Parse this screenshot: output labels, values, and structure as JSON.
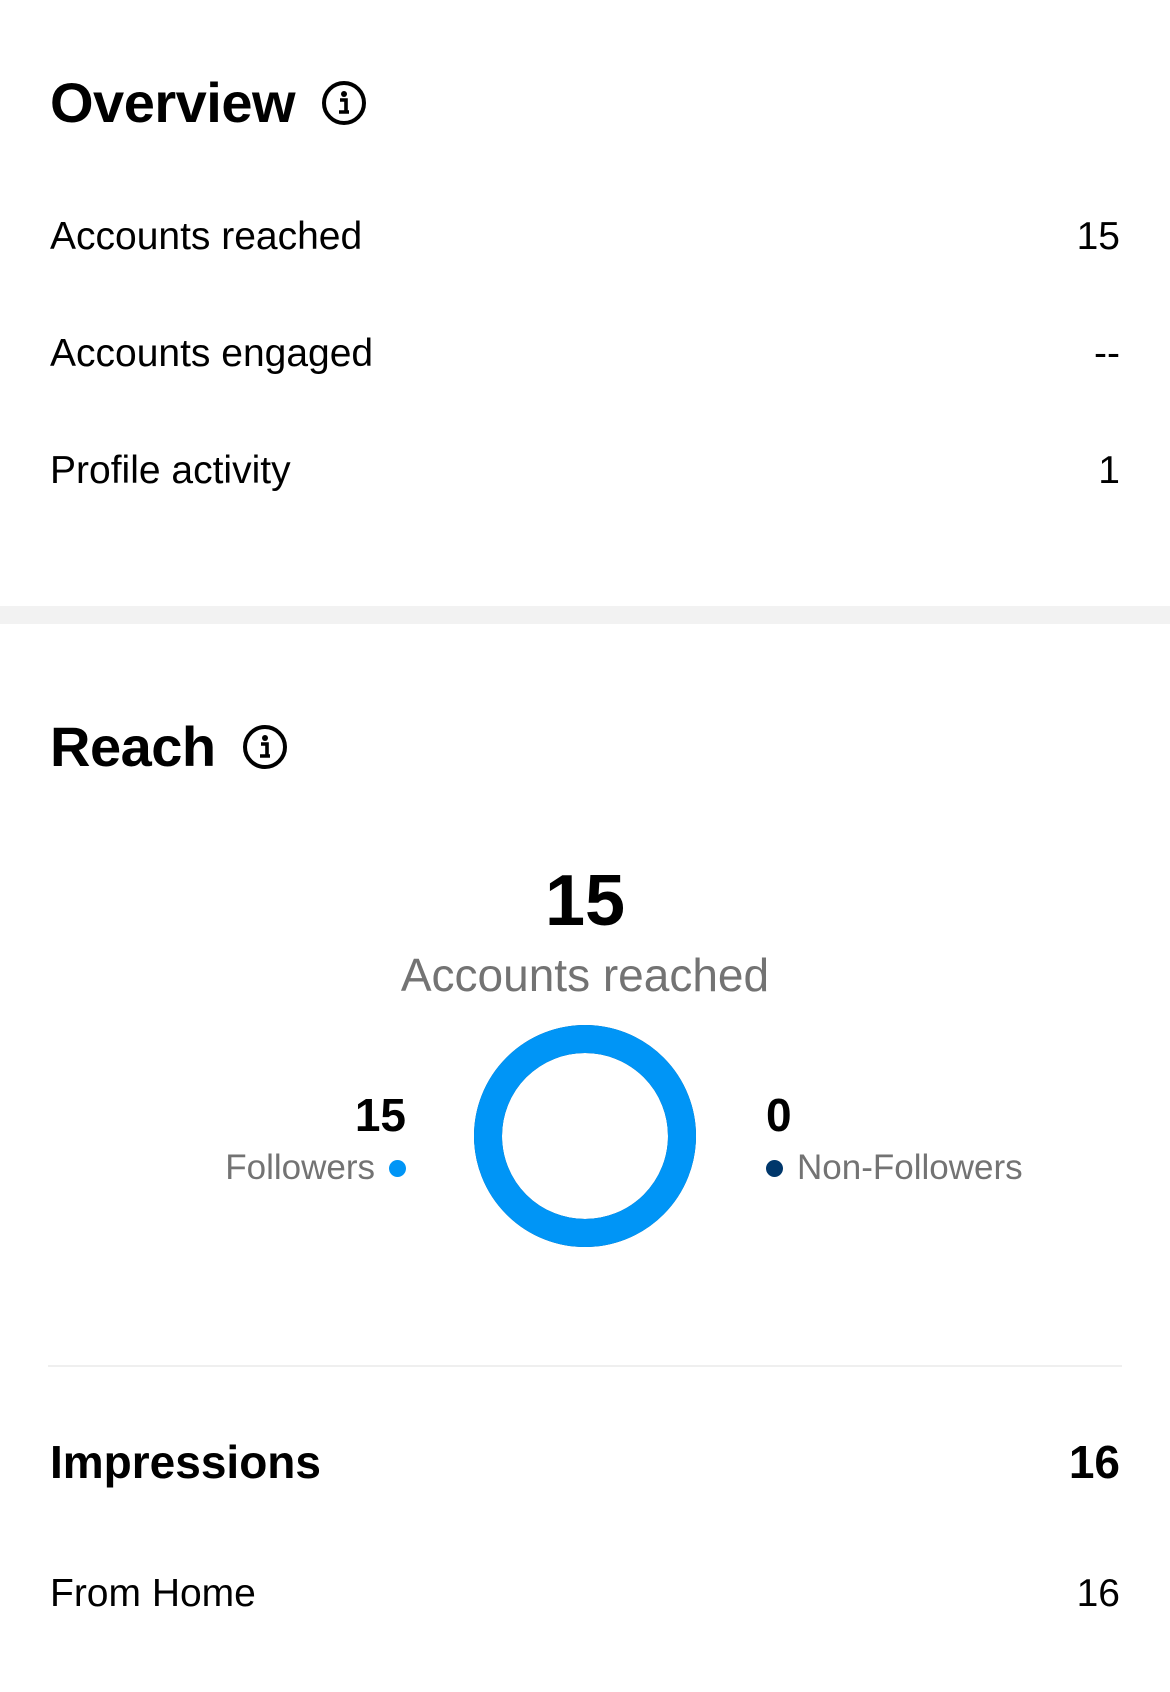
{
  "overview": {
    "title": "Overview",
    "info_icon": "info-icon",
    "rows": [
      {
        "label": "Accounts reached",
        "value": "15"
      },
      {
        "label": "Accounts engaged",
        "value": "--"
      },
      {
        "label": "Profile activity",
        "value": "1"
      }
    ]
  },
  "reach": {
    "title": "Reach",
    "info_icon": "info-icon",
    "total": "15",
    "total_label": "Accounts reached",
    "followers": {
      "value": "15",
      "label": "Followers",
      "color": "#0095f6"
    },
    "non_followers": {
      "value": "0",
      "label": "Non-Followers",
      "color": "#00376b"
    },
    "followers_fraction": 1.0
  },
  "impressions": {
    "title": "Impressions",
    "value": "16",
    "rows": [
      {
        "label": "From Home",
        "value": "16"
      }
    ]
  }
}
